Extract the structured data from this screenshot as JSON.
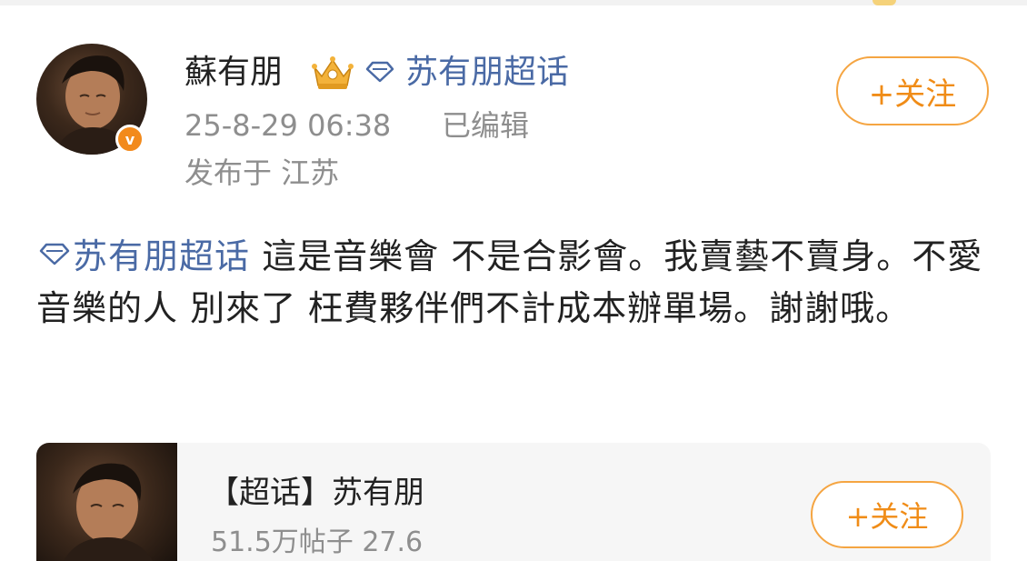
{
  "header": {
    "username": "蘇有朋",
    "topic_link": "苏有朋超话",
    "timestamp": "25-8-29 06:38",
    "edited_label": "已编辑",
    "location": "发布于 江苏",
    "follow_label": "+关注",
    "verified_badge": "v"
  },
  "post": {
    "topic_tag": "苏有朋超话",
    "text": "這是音樂會 不是合影會。我賣藝不賣身。不愛音樂的人 別來了 枉費夥伴們不計成本辦單場。謝謝哦。"
  },
  "card": {
    "title": "【超话】苏有朋",
    "stats": "51.5万帖子 27.6",
    "follow_label": "+关注"
  },
  "colors": {
    "accent_orange": "#f08c17",
    "link_blue": "#4a6aa5",
    "muted_gray": "#8e8e8e"
  },
  "icons": [
    "crown-icon",
    "diamond-icon",
    "verified-icon"
  ]
}
